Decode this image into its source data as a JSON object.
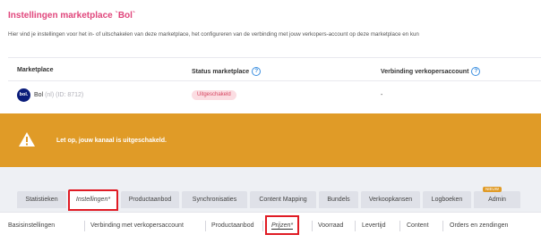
{
  "header": {
    "title": "Instellingen marketplace `Bol`",
    "description": "Hier vind je instellingen voor het in- of uitschakelen van deze marketplace, het configureren van de verbinding met jouw verkopers-account op deze marketplace en kun"
  },
  "table": {
    "columns": [
      "Marketplace",
      "Status marketplace",
      "Verbinding verkopersaccount"
    ],
    "row": {
      "logo_text": "bol.",
      "name": "Bol",
      "meta": "(nl) (ID: 8712)",
      "status": "Uitgeschakeld",
      "connection": "-"
    }
  },
  "alert": {
    "message": "Let op, jouw kanaal is uitgeschakeld."
  },
  "main_tabs": [
    {
      "label": "Statistieken"
    },
    {
      "label": "Instellingen*"
    },
    {
      "label": "Productaanbod"
    },
    {
      "label": "Synchronisaties"
    },
    {
      "label": "Content Mapping"
    },
    {
      "label": "Bundels"
    },
    {
      "label": "Verkoopkansen"
    },
    {
      "label": "Logboeken"
    },
    {
      "label": "Admin",
      "badge": "NIEUW"
    }
  ],
  "sub_tabs": [
    {
      "label": "Basisinstellingen"
    },
    {
      "label": "Verbinding met verkopersaccount"
    },
    {
      "label": "Productaanbod"
    },
    {
      "label": "Prijzen*"
    },
    {
      "label": "Voorraad"
    },
    {
      "label": "Levertijd"
    },
    {
      "label": "Content"
    },
    {
      "label": "Orders en zendingen"
    }
  ],
  "colors": {
    "title": "#e0457b",
    "warning_bg": "#e09b27",
    "badge_bg": "#fbdde2",
    "highlight_border": "#e01b24",
    "bol_logo": "#0a1c7a"
  },
  "icons": {
    "help": "question-circle-icon",
    "warning": "warning-triangle-icon"
  }
}
